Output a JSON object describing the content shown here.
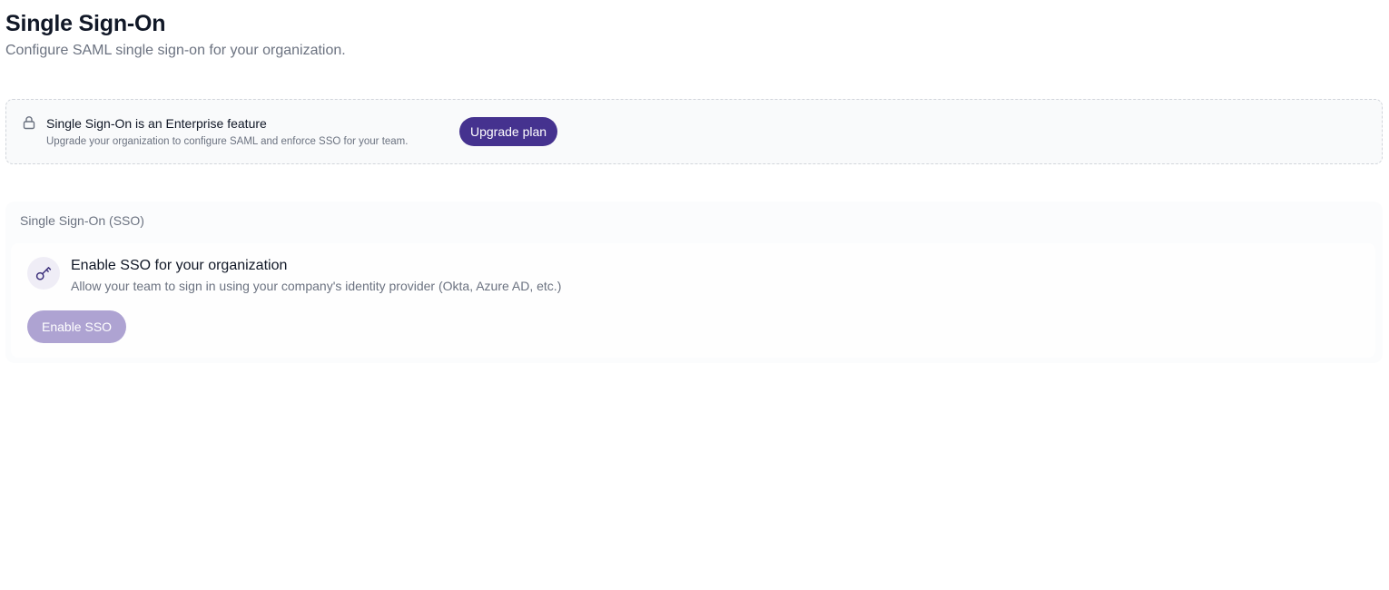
{
  "header": {
    "title": "Single Sign-On",
    "subtitle": "Configure SAML single sign-on for your organization."
  },
  "notice": {
    "icon": "lock-icon",
    "title": "Single Sign-On is an Enterprise feature",
    "description": "Upgrade your organization to configure SAML and enforce SSO for your team.",
    "button_label": "Upgrade plan"
  },
  "sso_section": {
    "label": "Single Sign-On (SSO)",
    "icon": "key-icon",
    "feature_title": "Enable SSO for your organization",
    "feature_description": "Allow your team to sign in using your company's identity provider (Okta, Azure AD, etc.)",
    "button_label": "Enable SSO",
    "button_disabled": true
  },
  "colors": {
    "primary": "#45328f",
    "primary_disabled": "#aea3d2",
    "icon_badge_bg": "#efedf6",
    "notice_bg": "#f9fafb",
    "border": "#d1d5db"
  }
}
